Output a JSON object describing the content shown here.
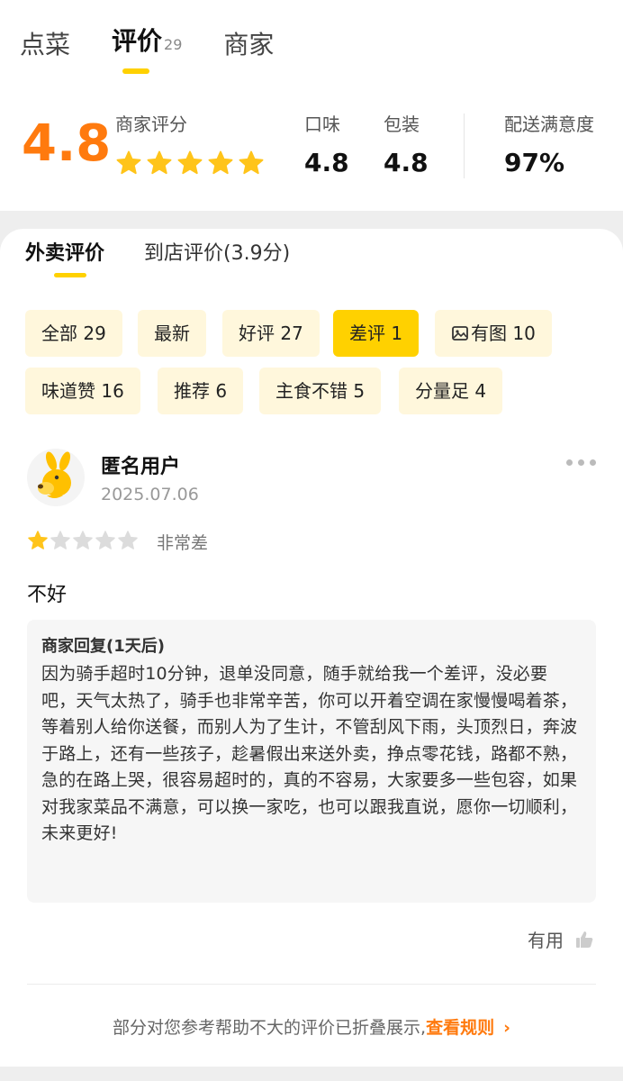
{
  "top_tabs": [
    {
      "label": "点菜"
    },
    {
      "label": "评价",
      "count": "29"
    },
    {
      "label": "商家"
    }
  ],
  "merchant_score": {
    "value": "4.8",
    "label": "商家评分",
    "stars": 5
  },
  "sub_scores": [
    {
      "label": "口味",
      "value": "4.8"
    },
    {
      "label": "包装",
      "value": "4.8"
    },
    {
      "label": "配送满意度",
      "value": "97%"
    }
  ],
  "review_tabs": [
    {
      "label": "外卖评价"
    },
    {
      "label": "到店评价(3.9分)"
    }
  ],
  "filter_chips": [
    {
      "label": "全部 29"
    },
    {
      "label": "最新"
    },
    {
      "label": "好评 27"
    },
    {
      "label": "差评 1",
      "selected": true
    },
    {
      "label": "有图 10",
      "icon": "image-icon"
    },
    {
      "label": "味道赞 16"
    },
    {
      "label": "推荐 6"
    },
    {
      "label": "主食不错 5"
    },
    {
      "label": "分量足 4"
    }
  ],
  "review": {
    "user": "匿名用户",
    "date": "2025.07.06",
    "rating": 1,
    "max_rating": 5,
    "rating_text": "非常差",
    "content": "不好",
    "reply_title": "商家回复(1天后)",
    "reply_body": "因为骑手超时10分钟，退单没同意，随手就给我一个差评，没必要吧，天气太热了，骑手也非常辛苦，你可以开着空调在家慢慢喝着茶，等着别人给你送餐，而别人为了生计，不管刮风下雨，头顶烈日，奔波于路上，还有一些孩子，趁暑假出来送外卖，挣点零花钱，路都不熟，急的在路上哭，很容易超时的，真的不容易，大家要多一些包容，如果对我家菜品不满意，可以换一家吃，也可以跟我直说，愿你一切顺利，未来更好!",
    "useful_label": "有用"
  },
  "fold_notice": {
    "text": "部分对您参考帮助不大的评价已折叠展示,",
    "link": "查看规则"
  },
  "colors": {
    "accent_yellow": "#ffd100",
    "score_orange": "#ff7a0e",
    "chip_bg": "#fff7dc"
  }
}
